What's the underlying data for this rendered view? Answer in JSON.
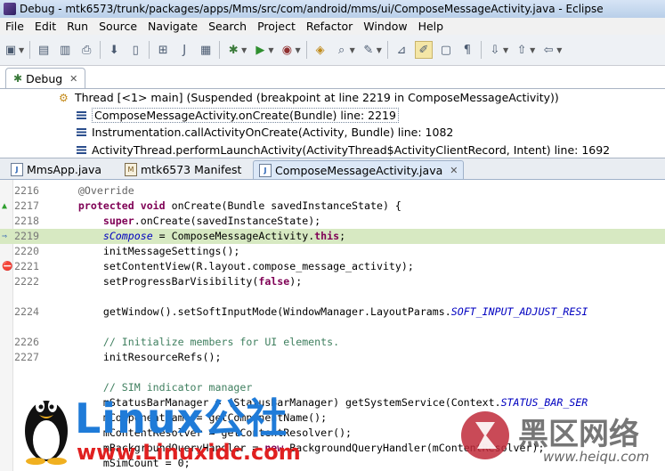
{
  "window": {
    "title": "Debug - mtk6573/trunk/packages/apps/Mms/src/com/android/mms/ui/ComposeMessageActivity.java - Eclipse"
  },
  "menubar": {
    "items": [
      "File",
      "Edit",
      "Run",
      "Source",
      "Navigate",
      "Search",
      "Project",
      "Refactor",
      "Window",
      "Help"
    ]
  },
  "debug_view": {
    "tab_label": "Debug",
    "thread": "Thread [<1> main] (Suspended (breakpoint at line 2219 in ComposeMessageActivity))",
    "frames": [
      "ComposeMessageActivity.onCreate(Bundle) line: 2219",
      "Instrumentation.callActivityOnCreate(Activity, Bundle) line: 1082",
      "ActivityThread.performLaunchActivity(ActivityThread$ActivityClientRecord, Intent) line: 1692"
    ]
  },
  "editor_tabs": [
    {
      "label": "MmsApp.java"
    },
    {
      "label": "mtk6573 Manifest"
    },
    {
      "label": "ComposeMessageActivity.java"
    }
  ],
  "code_lines": [
    {
      "num": "2216",
      "tokens": [
        [
          "an",
          "    @Override"
        ]
      ]
    },
    {
      "num": "2217",
      "tokens": [
        [
          "kw",
          "    protected void "
        ],
        [
          "pl",
          "onCreate(Bundle savedInstanceState) {"
        ]
      ]
    },
    {
      "num": "2218",
      "tokens": [
        [
          "pl",
          "        "
        ],
        [
          "kw",
          "super"
        ],
        [
          "pl",
          ".onCreate(savedInstanceState);"
        ]
      ]
    },
    {
      "num": "2219",
      "tokens": [
        [
          "pl",
          "        "
        ],
        [
          "fld",
          "sCompose"
        ],
        [
          "pl",
          " = ComposeMessageActivity."
        ],
        [
          "kw",
          "this"
        ],
        [
          "pl",
          ";"
        ]
      ]
    },
    {
      "num": "2220",
      "tokens": [
        [
          "pl",
          "        initMessageSettings();"
        ]
      ]
    },
    {
      "num": "2221",
      "tokens": [
        [
          "pl",
          "        setContentView(R.layout.compose_message_activity);"
        ]
      ]
    },
    {
      "num": "2222",
      "tokens": [
        [
          "pl",
          "        setProgressBarVisibility("
        ],
        [
          "kw",
          "false"
        ],
        [
          "pl",
          ");"
        ]
      ]
    },
    {
      "num": "",
      "tokens": []
    },
    {
      "num": "2224",
      "tokens": [
        [
          "pl",
          "        getWindow().setSoftInputMode(WindowManager.LayoutParams."
        ],
        [
          "fld",
          "SOFT_INPUT_ADJUST_RESI"
        ]
      ]
    },
    {
      "num": "",
      "tokens": []
    },
    {
      "num": "2226",
      "tokens": [
        [
          "cm",
          "        // Initialize members for UI elements."
        ]
      ]
    },
    {
      "num": "2227",
      "tokens": [
        [
          "pl",
          "        initResourceRefs();"
        ]
      ]
    },
    {
      "num": "",
      "tokens": []
    },
    {
      "num": "",
      "tokens": [
        [
          "cm",
          "        // SIM indicator manager"
        ]
      ]
    },
    {
      "num": "",
      "tokens": [
        [
          "pl",
          "        mStatusBarManager = (StatusBarManager) getSystemService(Context."
        ],
        [
          "fld",
          "STATUS_BAR_SER"
        ]
      ]
    },
    {
      "num": "",
      "tokens": [
        [
          "pl",
          "        mComponentName = getComponentName();"
        ]
      ]
    },
    {
      "num": "",
      "tokens": [
        [
          "pl",
          "        mContentResolver = getContentResolver();"
        ]
      ]
    },
    {
      "num": "",
      "tokens": [
        [
          "pl",
          "        mBackgroundQueryHandler = "
        ],
        [
          "kw",
          "new"
        ],
        [
          "pl",
          " BackgroundQueryHandler(mContentResolver);"
        ]
      ]
    },
    {
      "num": "",
      "tokens": [
        [
          "pl",
          "        mSimCount = 0;"
        ]
      ]
    }
  ],
  "watermark": {
    "left_logo": "Linux公社",
    "left_url": "www.Linuxidc.com",
    "right_logo": "黑区网络",
    "right_url": "www.heiqu.com"
  }
}
